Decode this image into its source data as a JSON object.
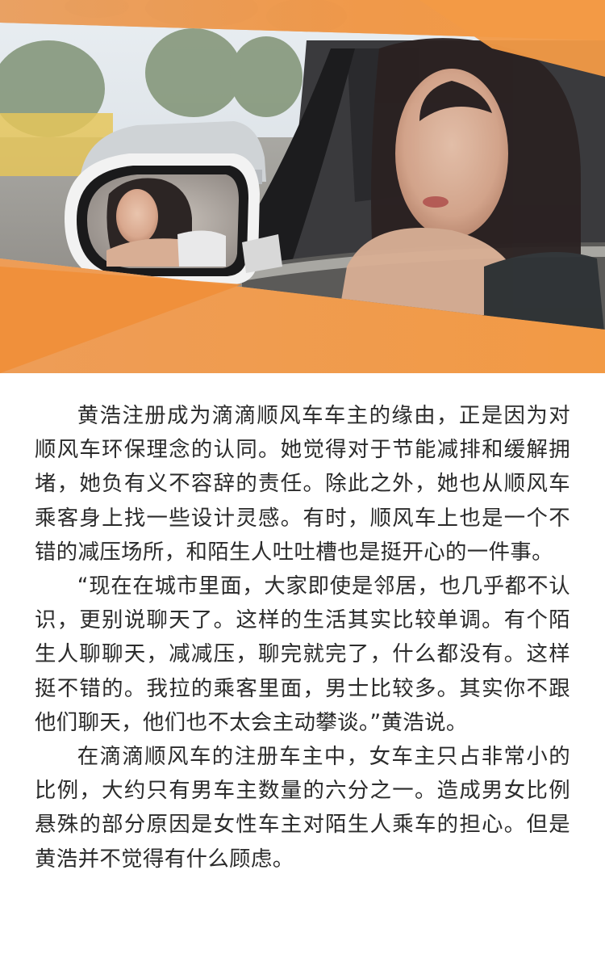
{
  "hero": {
    "image": "woman-in-car-side-mirror-photo"
  },
  "article": {
    "paragraphs": [
      "黄浩注册成为滴滴顺风车车主的缘由，正是因为对顺风车环保理念的认同。她觉得对于节能减排和缓解拥堵，她负有义不容辞的责任。除此之外，她也从顺风车乘客身上找一些设计灵感。有时，顺风车上也是一个不错的减压场所，和陌生人吐吐槽也是挺开心的一件事。",
      "“现在在城市里面，大家即使是邻居，也几乎都不认识，更别说聊天了。这样的生活其实比较单调。有个陌生人聊聊天，减减压，聊完就完了，什么都没有。这样挺不错的。我拉的乘客里面，男士比较多。其实你不跟他们聊天，他们也不太会主动攀谈。”黄浩说。",
      "在滴滴顺风车的注册车主中，女车主只占非常小的比例，大约只有男车主数量的六分之一。造成男女比例悬殊的部分原因是女性车主对陌生人乘车的担心。但是黄浩并不觉得有什么顾虑。"
    ]
  },
  "colors": {
    "accent_orange": "#f0953f",
    "text": "#2b2b2b",
    "background": "#ffffff"
  }
}
